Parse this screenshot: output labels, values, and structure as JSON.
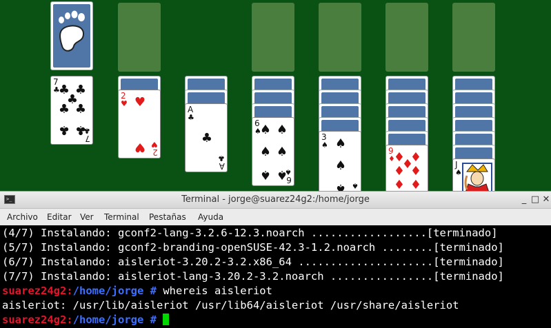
{
  "cards": {
    "col2_top": {
      "rank": "2",
      "suit": "♥"
    },
    "col3_top": {
      "rank": "A",
      "suit": "♣"
    },
    "col4_top": {
      "rank": "6",
      "suit": "♠"
    },
    "col5_top": {
      "rank": "3",
      "suit": "♠"
    },
    "col6_top": {
      "rank": "9",
      "suit": "♦"
    },
    "col7_top": {
      "rank": "J",
      "suit": "♠"
    },
    "waste": {
      "rank": "7",
      "suit": "♣"
    }
  },
  "terminal": {
    "title": "Terminal - jorge@suarez24g2:/home/jorge",
    "window_buttons": [
      "_",
      "□",
      "✕"
    ],
    "menu": [
      "Archivo",
      "Editar",
      "Ver",
      "Terminal",
      "Pestañas",
      "Ayuda"
    ],
    "lines": [
      "(4/7) Instalando: gconf2-lang-3.2.6-12.3.noarch ..................[terminado]",
      "(5/7) Instalando: gconf2-branding-openSUSE-42.3-1.2.noarch ........[terminado]",
      "(6/7) Instalando: aisleriot-3.20.2-3.2.x86_64 .....................[terminado]",
      "(7/7) Instalando: aisleriot-lang-3.20.2-3.2.noarch ................[terminado]"
    ],
    "prompt1_host": "suarez24g2:",
    "prompt1_path": "/home/jorge #",
    "command1": " whereis aisleriot",
    "output1": "aisleriot: /usr/lib/aisleriot /usr/lib64/aisleriot /usr/share/aisleriot",
    "prompt2_host": "suarez24g2:",
    "prompt2_path": "/home/jorge #"
  },
  "colors": {
    "felt": "#0a5114",
    "card_back": "#4f76a6",
    "prompt": "#e8132a",
    "path": "#3b6fff",
    "cursor": "#00d800"
  }
}
